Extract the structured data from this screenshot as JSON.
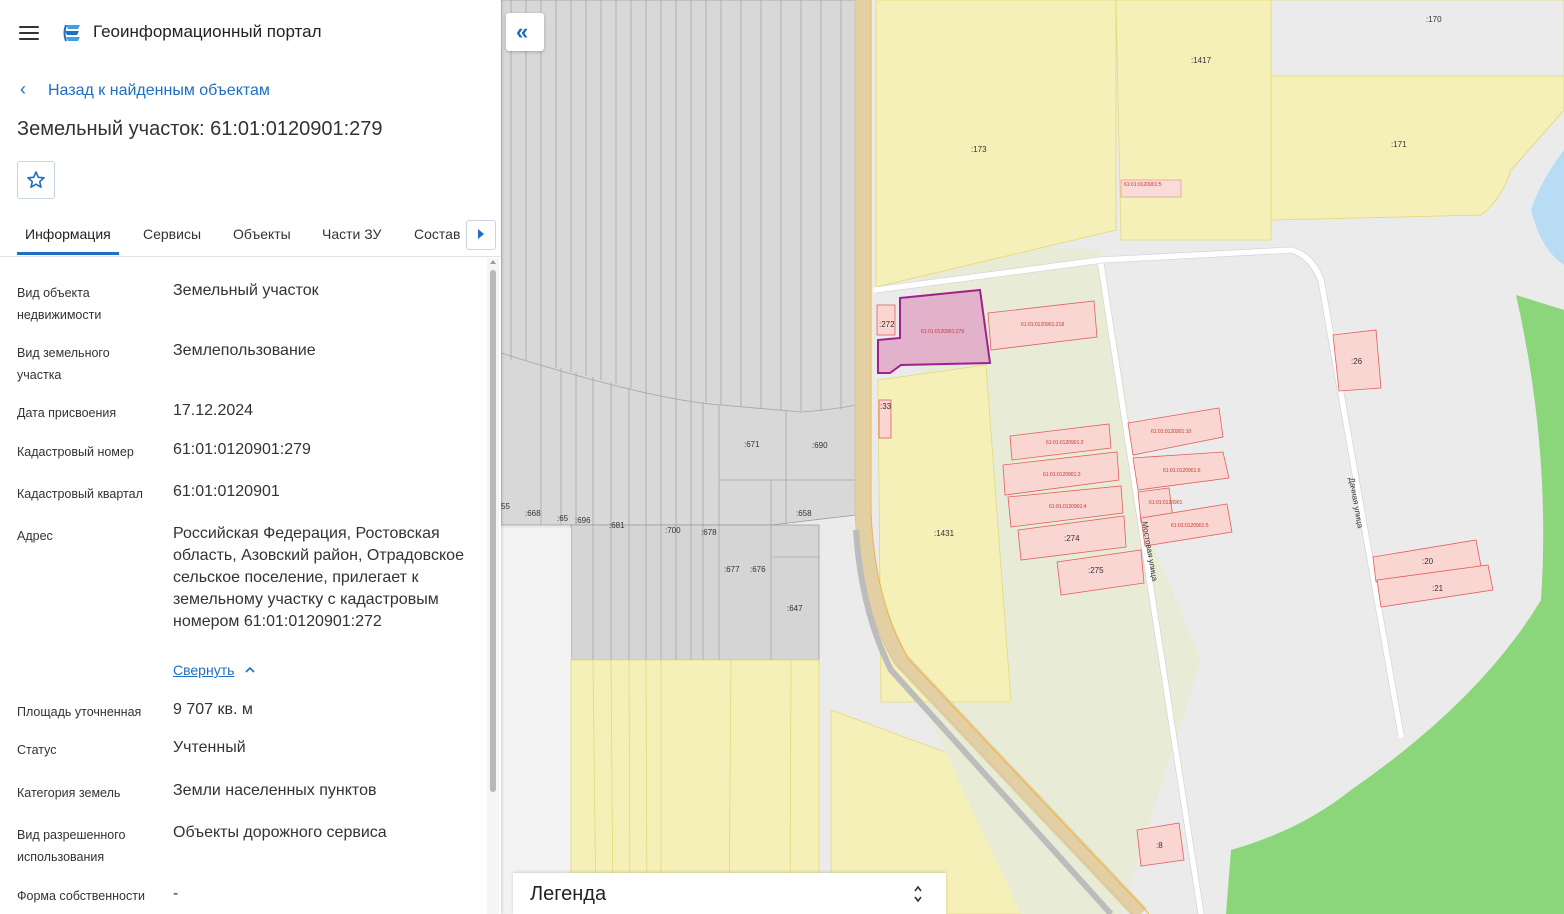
{
  "header": {
    "app_title": "Геоинформационный портал"
  },
  "back_link": "Назад к найденным объектам",
  "page_title": "Земельный участок: 61:01:0120901:279",
  "tabs": [
    "Информация",
    "Сервисы",
    "Объекты",
    "Части ЗУ",
    "Состав"
  ],
  "info": [
    {
      "label": "Вид объекта недвижимости",
      "value": "Земельный участок"
    },
    {
      "label": "Вид земельного участка",
      "value": "Землепользование"
    },
    {
      "label": "Дата присвоения",
      "value": "17.12.2024"
    },
    {
      "label": "Кадастровый номер",
      "value": "61:01:0120901:279"
    },
    {
      "label": "Кадастровый квартал",
      "value": "61:01:0120901"
    },
    {
      "label": "Адрес",
      "value": "Российская Федерация, Ростовская область, Азовский район, Отрадовское сельское поселение, прилегает к земельному участку с кадастровым номером 61:01:0120901:272"
    },
    {
      "label": "Площадь уточненная",
      "value": "9 707 кв. м"
    },
    {
      "label": "Статус",
      "value": "Учтенный"
    },
    {
      "label": "Категория земель",
      "value": "Земли населенных пунктов"
    },
    {
      "label": "Вид разрешенного использования",
      "value": "Объекты дорожного сервиса"
    },
    {
      "label": "Форма собственности",
      "value": "-"
    }
  ],
  "collapse_link": "Свернуть",
  "legend_title": "Легенда",
  "map_labels": {
    "parcels": [
      ":170",
      ":1417",
      ":173",
      ":171",
      ":272",
      ":33",
      ":671",
      ":690",
      ":658",
      ":678",
      ":677",
      ":676",
      ":647",
      "55",
      ":668",
      ":65",
      ":696",
      ":681",
      ":700",
      ":1431",
      ":274",
      ":275",
      ":26",
      ":20",
      ":21",
      ":8"
    ],
    "streets": [
      "Мостовая улица",
      "Дачная улица"
    ]
  },
  "colors": {
    "accent": "#1e6ec4",
    "selected_parcel": "#a0208e",
    "yellow_parcel": "#f5f0b8",
    "green_area": "#8bd67a",
    "water": "#b9dcf5"
  },
  "icons": [
    "menu-icon",
    "portal-logo-icon",
    "chevron-left-icon",
    "star-icon",
    "chevron-right-icon",
    "chevron-up-icon",
    "double-chevron-left-icon",
    "expand-toggle-icon"
  ]
}
